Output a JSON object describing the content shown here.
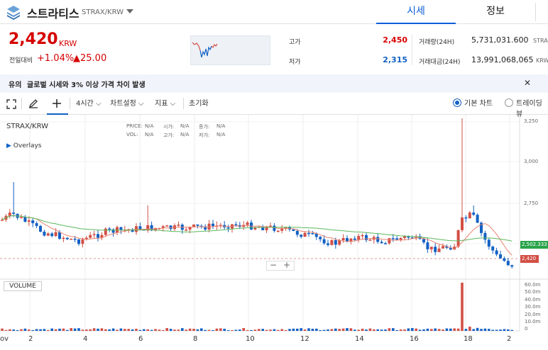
{
  "header": {
    "coin_name": "스트라티스",
    "pair": "STRAX/KRW",
    "tabs": [
      {
        "label": "시세"
      },
      {
        "label": "정보"
      }
    ]
  },
  "price": {
    "current": "2,420",
    "unit": "KRW",
    "prev_label": "전일대비",
    "change_pct": "+1.04%",
    "change_abs": "▲25.00"
  },
  "stats": {
    "high_label": "고가",
    "high_value": "2,450",
    "low_label": "저가",
    "low_value": "2,315",
    "volume_label": "거래량(24H)",
    "volume_value": "5,731,031.600",
    "volume_unit": "STRAX",
    "amount_label": "거래대금(24H)",
    "amount_value": "13,991,068,065",
    "amount_unit": "KRW"
  },
  "notice": {
    "tag": "유의",
    "text": "글로벌 시세와 3% 이상 가격 차이 발생"
  },
  "toolbar": {
    "interval": "4시간",
    "chart_settings": "차트설정",
    "indicators": "지표",
    "reset": "초기화",
    "basic_chart": "기본 차트",
    "trading_view": "트레이딩뷰"
  },
  "chart": {
    "symbol": "STRAX/KRW",
    "overlays": "Overlays",
    "price_label": "PRICE:",
    "price_val": "N/A",
    "open_label": "시가:",
    "open_val": "N/A",
    "close_label": "종가:",
    "close_val": "N/A",
    "vol_label": "VOL:",
    "vol_val": "N/A",
    "high_label": "고가:",
    "high_val": "N/A",
    "low_label": "저가:",
    "low_val": "N/A",
    "volume_pane_label": "VOLUME",
    "zoom_out": "−",
    "zoom_in": "+",
    "ma_badge": "2,502.333",
    "price_badge": "2,420",
    "y_ticks": [
      "3,250",
      "3,000",
      "2,750",
      "2,500"
    ],
    "vol_ticks": [
      "60.0m",
      "50.0m",
      "40.0m",
      "30.0m",
      "20.0m",
      "10.0m",
      "0"
    ],
    "x_ticks": [
      "ov",
      "2",
      "4",
      "6",
      "8",
      "10",
      "12",
      "14",
      "16",
      "18",
      "2"
    ],
    "colors": {
      "up": "#d24f45",
      "down": "#1261c4",
      "ma_short": "#e8846f",
      "ma_long": "#5cb85c"
    }
  },
  "chart_data": {
    "type": "candlestick",
    "x": [
      "2",
      "4",
      "6",
      "8",
      "10",
      "12",
      "14",
      "16",
      "18"
    ],
    "ylim": [
      2250,
      3270
    ],
    "close": [
      2600,
      2560,
      2580,
      2570,
      2590,
      2540,
      2520,
      2500,
      2650,
      2420
    ],
    "volume_spike": "60.0m"
  }
}
